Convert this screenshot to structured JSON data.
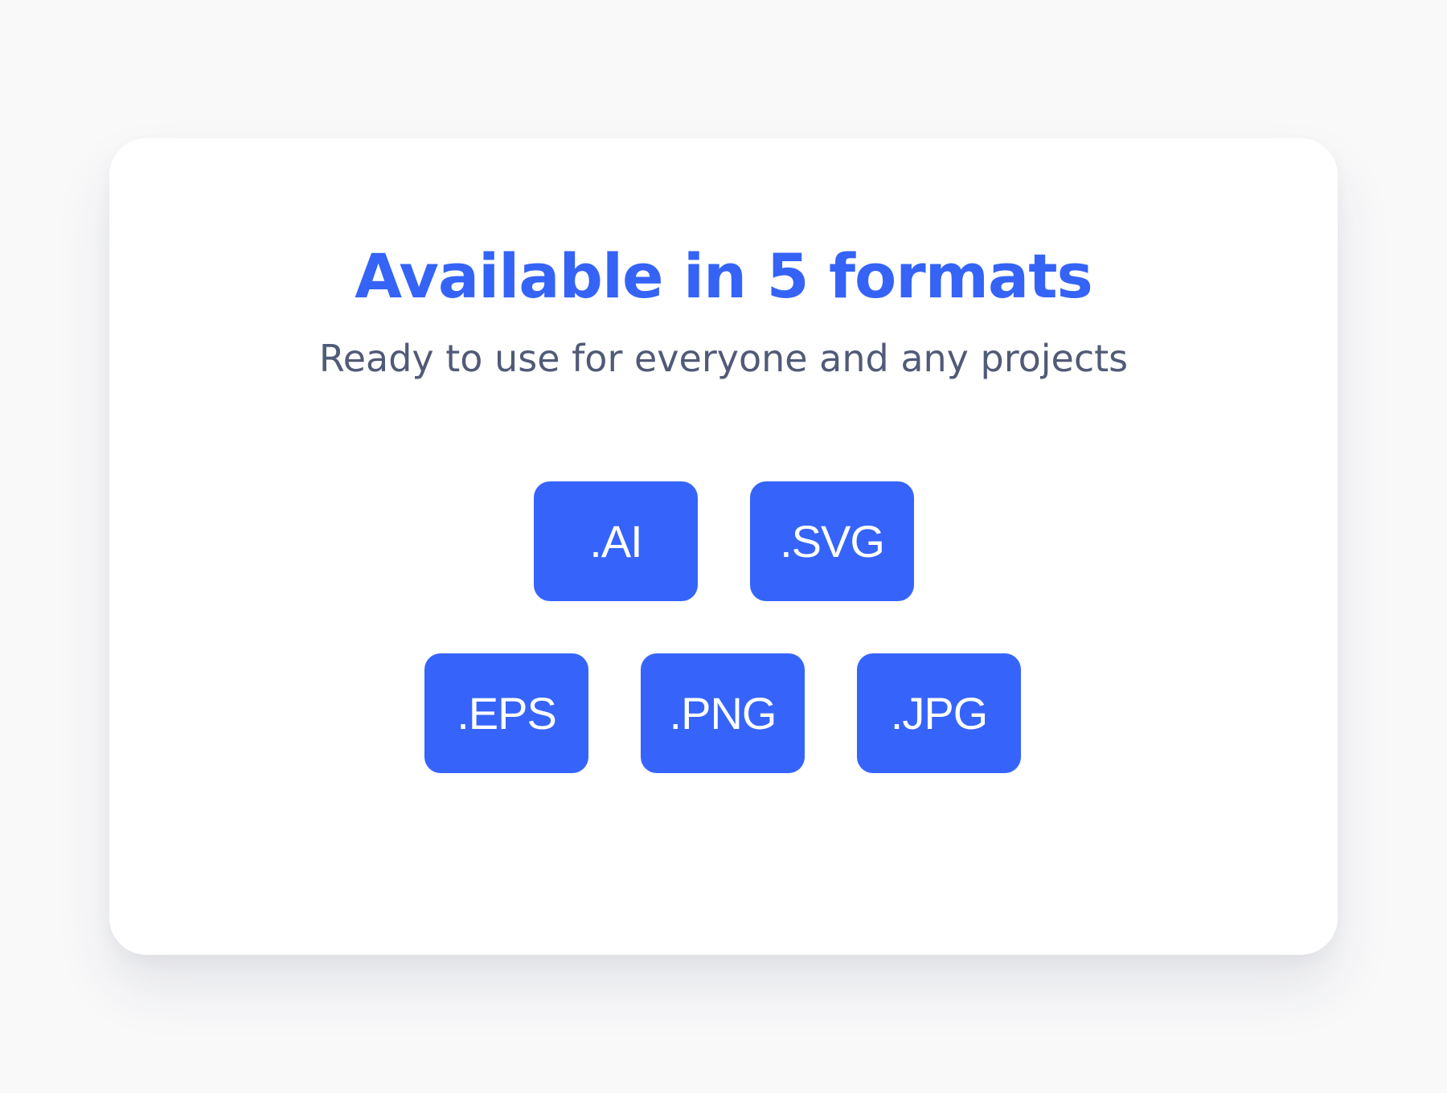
{
  "page": {
    "title": "Available in 5 formats",
    "subtitle": "Ready to use for everyone and any projects"
  },
  "formats": [
    ".AI",
    ".SVG",
    ".EPS",
    ".PNG",
    ".JPG"
  ],
  "colors": {
    "accent": "#3664fb",
    "title": "#3563f6",
    "subtitle": "#515a77",
    "background": "#f9f9fa",
    "card": "#ffffff"
  }
}
